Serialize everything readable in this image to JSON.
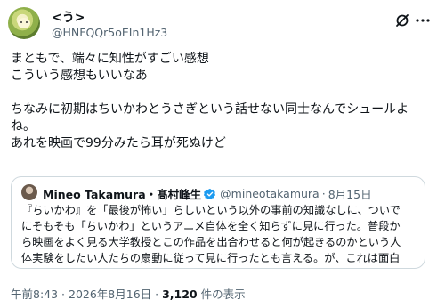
{
  "tweet": {
    "display_name": "<う>",
    "handle": "@HNFQQr5oEIn1Hz3",
    "body_lines": [
      "まともで、端々に知性がすごい感想",
      "こういう感想もいいなあ",
      "",
      "ちなみに初期はちいかわとうさぎという話せない同士なんでシュールよ",
      "ね。",
      "あれを映画で99分みたら耳が死ぬけど"
    ]
  },
  "quote": {
    "author_name": "Mineo Takamura・髙村峰生",
    "author_handle": "@mineotakamura",
    "separator": "·",
    "date": "8月15日",
    "body_lines": [
      "『ちいかわ』を「最後が怖い」らしいという以外の事前の知識なしに、ついで",
      "にそもそも「ちいかわ」というアニメ自体を全く知らずに見に行った。普段か",
      "ら映画をよく見る大学教授とこの作品を出合わせると何が起きるのかという人",
      "体実験をしたい人たちの扇動に従って見に行ったとも言える。が、これは面白"
    ]
  },
  "footer": {
    "timestamp": "午前8:43 · 2026年8月16日 · ",
    "views_count": "3,120",
    "views_label": " 件の表示"
  },
  "icons": {
    "grok": "grok-icon",
    "more": "more-icon",
    "verified": "verified-badge-icon"
  },
  "colors": {
    "text": "#0f1419",
    "secondary": "#536471",
    "border": "#cfd9de",
    "verified": "#1d9bf0"
  }
}
